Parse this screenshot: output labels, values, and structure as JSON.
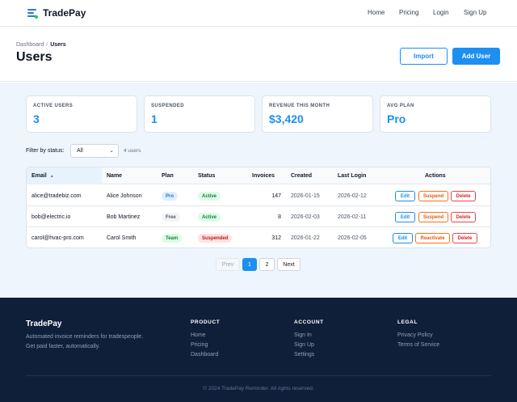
{
  "nav": {
    "brand": "TradePay",
    "links": [
      "Home",
      "Pricing",
      "Login",
      "Sign Up"
    ]
  },
  "header": {
    "breadcrumb": [
      "Dashboard",
      "/",
      "Users"
    ],
    "title": "Users",
    "import_label": "Import",
    "add_label": "Add User"
  },
  "stats": [
    {
      "label": "ACTIVE USERS",
      "value": "3"
    },
    {
      "label": "SUSPENDED",
      "value": "1"
    },
    {
      "label": "REVENUE THIS MONTH",
      "value": "$3,420"
    },
    {
      "label": "AVG PLAN",
      "value": "Pro"
    }
  ],
  "filter": {
    "label": "Filter by status:",
    "selected": "All",
    "count": "4 users"
  },
  "table": {
    "columns": [
      "Email",
      "Name",
      "Plan",
      "Status",
      "Invoices",
      "Created",
      "Last Login",
      "Actions"
    ],
    "sort_icon": "▲",
    "rows": [
      {
        "email": "alice@tradebiz.com",
        "name": "Alice Johnson",
        "plan": "Pro",
        "status": "Active",
        "invoices": "147",
        "created": "2026-01-15",
        "last_login": "2026-02-12",
        "actions": [
          "Edit",
          "Suspend",
          "Delete"
        ]
      },
      {
        "email": "bob@electric.io",
        "name": "Bob Martinez",
        "plan": "Free",
        "status": "Active",
        "invoices": "8",
        "created": "2026-02-03",
        "last_login": "2026-02-11",
        "actions": [
          "Edit",
          "Suspend",
          "Delete"
        ]
      },
      {
        "email": "carol@hvac-pro.com",
        "name": "Carol Smith",
        "plan": "Team",
        "status": "Suspended",
        "invoices": "312",
        "created": "2026-01-22",
        "last_login": "2026-02-05",
        "actions": [
          "Edit",
          "Reactivate",
          "Delete"
        ]
      }
    ]
  },
  "pagination": {
    "prev": "Prev",
    "pages": [
      "1",
      "2"
    ],
    "next": "Next"
  },
  "footer": {
    "brand": "TradePay",
    "description": "Automated invoice reminders for tradespeople. Get paid faster, automatically.",
    "columns": [
      {
        "heading": "PRODUCT",
        "links": [
          "Home",
          "Pricing",
          "Dashboard"
        ]
      },
      {
        "heading": "ACCOUNT",
        "links": [
          "Sign In",
          "Sign Up",
          "Settings"
        ]
      },
      {
        "heading": "LEGAL",
        "links": [
          "Privacy Policy",
          "Terms of Service"
        ]
      }
    ],
    "copyright": "© 2024 TradePay Reminder. All rights reserved."
  },
  "colors": {
    "accent": "#1d8ff0",
    "footer_bg": "#0f1f3a",
    "page_bg": "#eef5fc"
  }
}
